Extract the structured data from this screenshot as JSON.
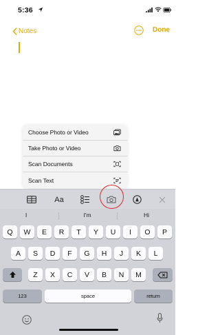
{
  "status_bar": {
    "time": "5:36"
  },
  "nav": {
    "back_label": "Notes",
    "done_label": "Done"
  },
  "menu": {
    "items": [
      {
        "label": "Choose Photo or Video",
        "icon": "photo-library-icon"
      },
      {
        "label": "Take Photo or Video",
        "icon": "camera-icon"
      },
      {
        "label": "Scan Documents",
        "icon": "scan-document-icon"
      },
      {
        "label": "Scan Text",
        "icon": "scan-text-icon"
      }
    ]
  },
  "toolbar": {
    "items": [
      "table-icon",
      "Aa",
      "checklist-icon",
      "camera-icon",
      "markup-icon",
      "close-icon"
    ],
    "format_label": "Aa",
    "highlight_color": "#e0262a"
  },
  "keyboard": {
    "suggestions": [
      "I",
      "I'm",
      "Hi"
    ],
    "row1": [
      "Q",
      "W",
      "E",
      "R",
      "T",
      "Y",
      "U",
      "I",
      "O",
      "P"
    ],
    "row2": [
      "A",
      "S",
      "D",
      "F",
      "G",
      "H",
      "J",
      "K",
      "L"
    ],
    "row3": [
      "Z",
      "X",
      "C",
      "V",
      "B",
      "N",
      "M"
    ],
    "numbers_label": "123",
    "space_label": "space",
    "return_label": "return"
  },
  "colors": {
    "accent": "#e2a900",
    "keyboard_bg": "#d1d3d9",
    "key_bg": "#fcfcfe"
  }
}
